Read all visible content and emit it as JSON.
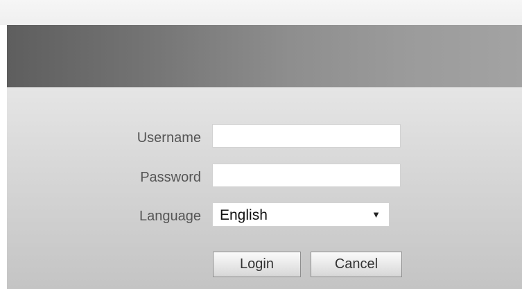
{
  "form": {
    "username_label": "Username",
    "username_value": "",
    "password_label": "Password",
    "password_value": "",
    "language_label": "Language",
    "language_selected": "English",
    "dropdown_icon": "▼"
  },
  "actions": {
    "login_label": "Login",
    "cancel_label": "Cancel"
  },
  "colors": {
    "banner_start": "#5e5e5e",
    "banner_end": "#a3a3a3",
    "panel_top": "#f0f0f0",
    "panel_bottom": "#c4c4c4"
  }
}
